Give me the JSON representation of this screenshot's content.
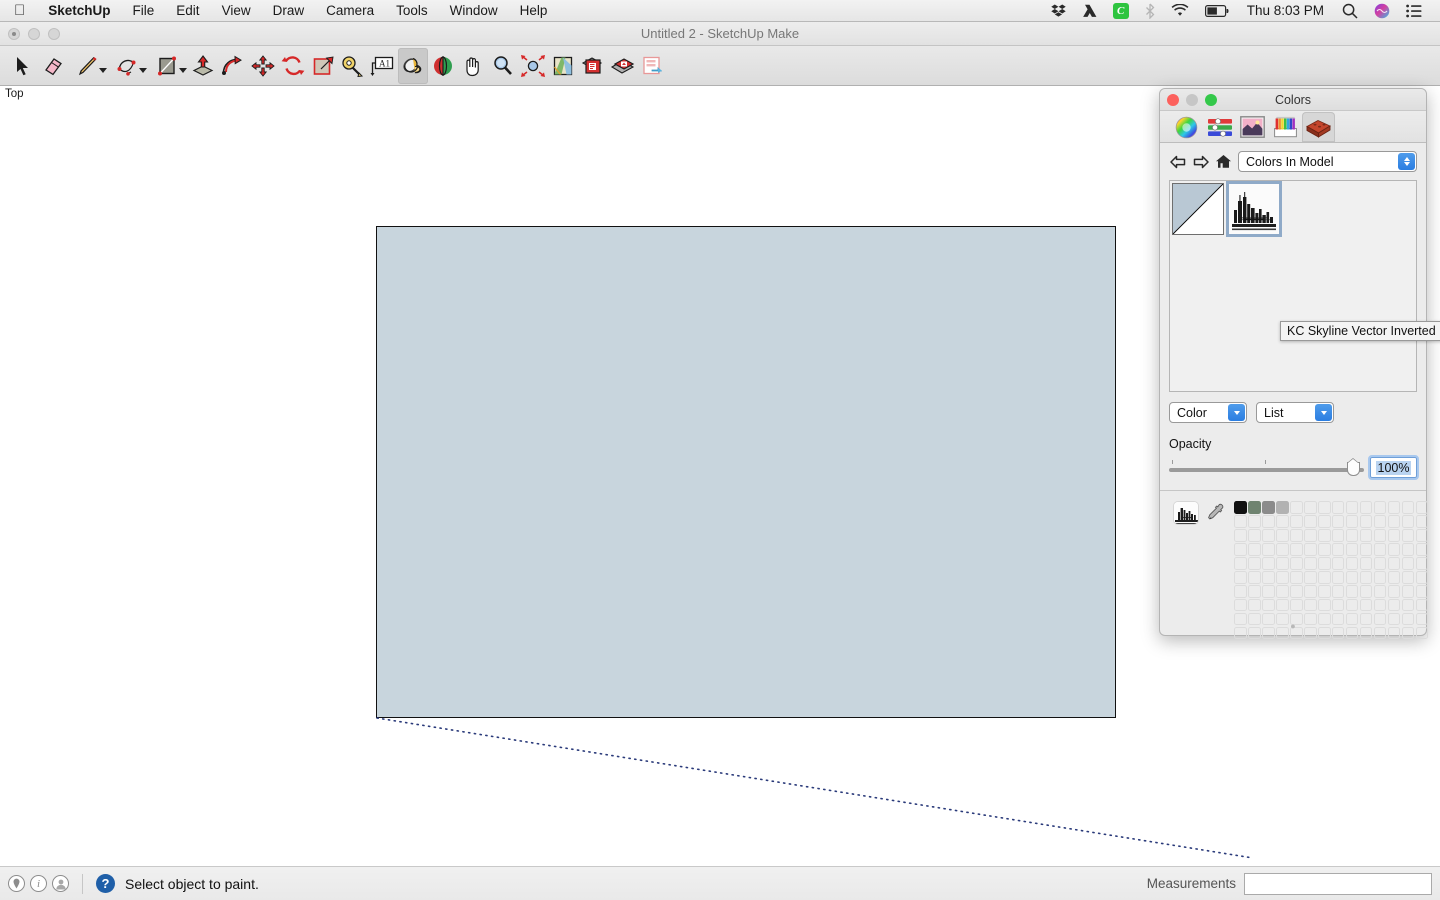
{
  "menubar": {
    "apple_icon": "apple-icon",
    "items": [
      {
        "label": "SketchUp",
        "bold": true
      },
      {
        "label": "File"
      },
      {
        "label": "Edit"
      },
      {
        "label": "View"
      },
      {
        "label": "Draw"
      },
      {
        "label": "Camera"
      },
      {
        "label": "Tools"
      },
      {
        "label": "Window"
      },
      {
        "label": "Help"
      }
    ],
    "tray": [
      {
        "name": "dropbox-icon"
      },
      {
        "name": "google-drive-icon"
      },
      {
        "name": "camtasia-icon",
        "label": "C",
        "color": "#2ec43f"
      },
      {
        "name": "bluetooth-icon"
      },
      {
        "name": "wifi-icon"
      },
      {
        "name": "battery-icon"
      }
    ],
    "clock": "Thu 8:03 PM",
    "spotlight_icon": "search-icon",
    "siri_icon": "siri-icon",
    "notifications_icon": "notification-center-icon"
  },
  "window": {
    "title": "Untitled 2 - SketchUp Make"
  },
  "toolbar": {
    "tools": [
      {
        "name": "select-tool",
        "label": "Select",
        "dropdown": false,
        "active": false
      },
      {
        "name": "eraser-tool",
        "label": "Eraser",
        "dropdown": false,
        "active": false
      },
      {
        "name": "line-tool",
        "label": "Line",
        "dropdown": true,
        "active": false
      },
      {
        "name": "arc-tool",
        "label": "Arc",
        "dropdown": true,
        "active": false
      },
      {
        "name": "rectangle-tool",
        "label": "Rectangle",
        "dropdown": true,
        "active": false
      },
      {
        "name": "push-pull-tool",
        "label": "Push/Pull",
        "dropdown": false,
        "active": false
      },
      {
        "name": "follow-me-tool",
        "label": "Follow Me",
        "dropdown": false,
        "active": false
      },
      {
        "name": "move-tool",
        "label": "Move",
        "dropdown": false,
        "active": false
      },
      {
        "name": "rotate-tool",
        "label": "Rotate",
        "dropdown": false,
        "active": false
      },
      {
        "name": "scale-tool",
        "label": "Scale",
        "dropdown": false,
        "active": false
      },
      {
        "name": "tape-measure-tool",
        "label": "Tape Measure",
        "dropdown": false,
        "active": false
      },
      {
        "name": "text-tool",
        "label": "Text",
        "dropdown": false,
        "active": false
      },
      {
        "name": "paint-bucket-tool",
        "label": "Paint Bucket",
        "dropdown": false,
        "active": true
      },
      {
        "name": "orbit-tool",
        "label": "Orbit",
        "dropdown": false,
        "active": false
      },
      {
        "name": "pan-tool",
        "label": "Pan",
        "dropdown": false,
        "active": false
      },
      {
        "name": "zoom-tool",
        "label": "Zoom",
        "dropdown": false,
        "active": false
      },
      {
        "name": "zoom-extents-tool",
        "label": "Zoom Extents",
        "dropdown": false,
        "active": false
      },
      {
        "name": "geo-location-tool",
        "label": "Add Location",
        "dropdown": false,
        "active": false
      },
      {
        "name": "get-models-tool",
        "label": "3D Warehouse",
        "dropdown": false,
        "active": false
      },
      {
        "name": "share-model-tool",
        "label": "Share Model",
        "dropdown": false,
        "active": false
      },
      {
        "name": "layout-tool",
        "label": "Send to LayOut",
        "dropdown": false,
        "active": false
      }
    ]
  },
  "canvas": {
    "view_label": "Top",
    "rectangle_fill": "#c8d5dd",
    "rectangle_stroke": "#111111",
    "inference_line_color": "#2a3a7a"
  },
  "statusbar": {
    "icons": [
      {
        "name": "location-pin-icon"
      },
      {
        "name": "info-icon"
      },
      {
        "name": "account-icon"
      },
      {
        "name": "help-icon"
      }
    ],
    "status_text": "Select object to paint.",
    "measurements_label": "Measurements",
    "measurements_value": "",
    "measurements_placeholder": ""
  },
  "colors_panel": {
    "title": "Colors",
    "traffic_lights": [
      {
        "name": "close-button",
        "color": "#fc615d"
      },
      {
        "name": "minimize-button",
        "color": "#c6c6c6"
      },
      {
        "name": "zoom-button",
        "color": "#34c84a"
      }
    ],
    "tabs": [
      {
        "name": "color-wheel-tab",
        "label": "Color Wheel",
        "selected": false
      },
      {
        "name": "color-sliders-tab",
        "label": "Color Sliders",
        "selected": false
      },
      {
        "name": "color-palettes-tab",
        "label": "Image Palettes",
        "selected": false
      },
      {
        "name": "crayons-tab",
        "label": "Crayons",
        "selected": false
      },
      {
        "name": "sketchup-materials-tab",
        "label": "SketchUp Materials",
        "selected": true
      }
    ],
    "nav": {
      "back_icon": "back-arrow-icon",
      "forward_icon": "forward-arrow-icon",
      "home_icon": "home-icon",
      "category_value": "Colors In Model"
    },
    "materials": [
      {
        "name": "default-material-swatch",
        "label": "Default",
        "selected": false,
        "kind": "default"
      },
      {
        "name": "kc-skyline-material-swatch",
        "label": "KC Skyline Vector Inverted",
        "selected": true,
        "kind": "texture"
      }
    ],
    "tooltip": "KC Skyline Vector Inverted",
    "selects": [
      {
        "name": "view-mode-select",
        "value": "Color"
      },
      {
        "name": "display-mode-select",
        "value": "List"
      }
    ],
    "opacity": {
      "label": "Opacity",
      "value": "100%",
      "percent": 100
    },
    "palette": {
      "favorite_icon": "favorite-material-icon",
      "eyedropper_icon": "eyedropper-icon",
      "columns": 14,
      "rows": 10,
      "filled": [
        "#111111",
        "#6f8370",
        "#8b8b8b",
        "#b2b2b2"
      ]
    }
  }
}
